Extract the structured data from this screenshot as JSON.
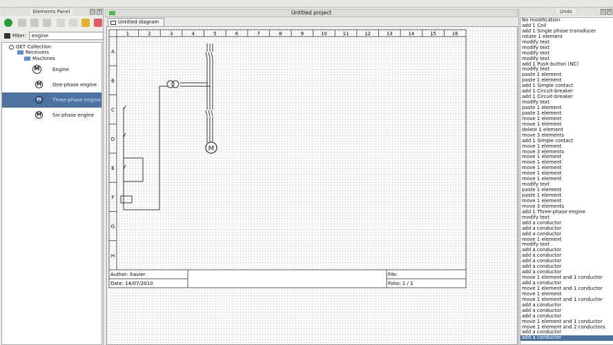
{
  "project_title": "Untitled project",
  "diagram_tab": "Untitled diagram [*]",
  "elements_panel": {
    "title": "Elements Panel",
    "filter_label": "Filter:",
    "filter_value": "engine",
    "tree": [
      {
        "label": "QET Collection",
        "level": 0
      },
      {
        "label": "Receivers",
        "level": 1
      },
      {
        "label": "Machines",
        "level": 2
      },
      {
        "label": "Engine",
        "level": 3
      },
      {
        "label": "One-phase engine",
        "level": 3
      },
      {
        "label": "Three-phase engine",
        "level": 3,
        "selected": true
      },
      {
        "label": "Six-phase engine",
        "level": 3
      }
    ]
  },
  "sheet": {
    "columns": [
      "1",
      "2",
      "3",
      "4",
      "5",
      "6",
      "7",
      "8",
      "9",
      "10",
      "11",
      "12",
      "13",
      "14",
      "15",
      "16"
    ],
    "rows": [
      "A",
      "B",
      "C",
      "D",
      "E",
      "F",
      "G",
      "H"
    ],
    "author": "Author: Xavier",
    "date": "Date: 14/07/2010",
    "file": "File:",
    "folio": "Folio: 1 / 1",
    "motor_label": "M"
  },
  "undo": {
    "title": "Undo",
    "items": [
      "No modification",
      "add 1 Coil",
      "add 1 Single phase transducer",
      "rotate 1 element",
      "modify text",
      "modify text",
      "modify text",
      "modify text",
      "add 1 Push-button (NC)",
      "modify text",
      "paste 1 element",
      "paste 1 element",
      "add 1 Simple contact",
      "add 1 Circuit-breaker",
      "add 1 Circuit-breaker",
      "modify text",
      "paste 1 element",
      "paste 1 element",
      "move 1 element",
      "move 1 element",
      "delete 1 element",
      "move 3 elements",
      "add 1 Simple contact",
      "move 1 element",
      "move 3 elements",
      "move 1 element",
      "move 1 element",
      "move 1 element",
      "move 1 element",
      "move 1 element",
      "modify text",
      "paste 1 element",
      "paste 1 element",
      "move 1 element",
      "move 3 elements",
      "add 1 Three-phase engine",
      "modify text",
      "add a conductor",
      "add a conductor",
      "add a conductor",
      "move 1 element",
      "modify text",
      "add a conductor",
      "add a conductor",
      "add a conductor",
      "add a conductor",
      "add a conductor",
      "move 1 element and 1 conductor",
      "add a conductor",
      "move 1 element and 1 conductor",
      "move 1 element",
      "move 1 element and 1 conductor",
      "add a conductor",
      "add a conductor",
      "add a conductor",
      "move 1 element and 1 conductor",
      "move 1 element and 2 conductors",
      "add a conductor",
      "add a conductor"
    ],
    "selected_index": 58
  },
  "colors": {
    "selection": "#4d73a3",
    "accent_green": "#2a9d3a"
  }
}
